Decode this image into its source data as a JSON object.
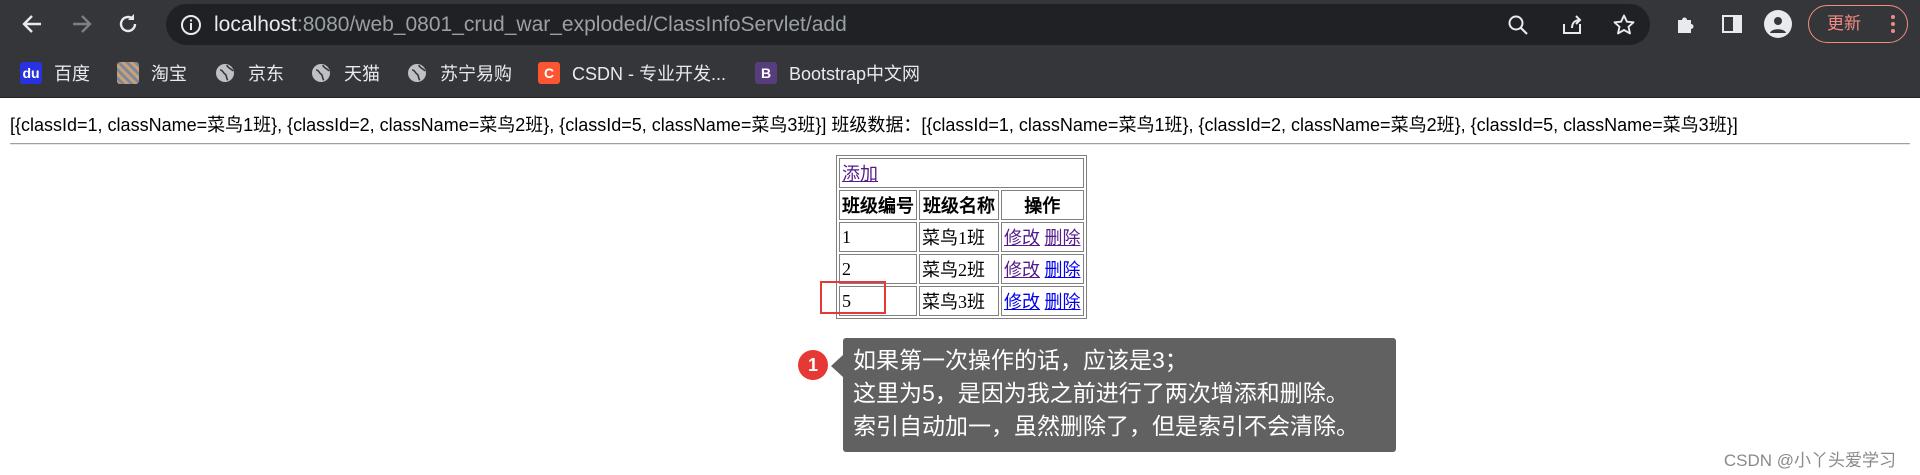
{
  "browser": {
    "url_host": "localhost",
    "url_rest": ":8080/web_0801_crud_war_exploded/ClassInfoServlet/add",
    "update_label": "更新"
  },
  "bookmarks": [
    {
      "label": "百度",
      "icon": "baidu-icon",
      "color": "#2932e1"
    },
    {
      "label": "淘宝",
      "icon": "taobao-icon",
      "color": "#8a8a8a"
    },
    {
      "label": "京东",
      "icon": "globe-icon",
      "color": "#bdc1c6"
    },
    {
      "label": "天猫",
      "icon": "globe-icon",
      "color": "#bdc1c6"
    },
    {
      "label": "苏宁易购",
      "icon": "globe-icon",
      "color": "#bdc1c6"
    },
    {
      "label": "CSDN - 专业开发...",
      "icon": "csdn-icon",
      "color": "#fc5531"
    },
    {
      "label": "Bootstrap中文网",
      "icon": "bootstrap-icon",
      "color": "#563d7c"
    }
  ],
  "page": {
    "debug_text": "[{classId=1, className=菜鸟1班}, {classId=2, className=菜鸟2班}, {classId=5, className=菜鸟3班}] 班级数据：[{classId=1, className=菜鸟1班}, {classId=2, className=菜鸟2班}, {classId=5, className=菜鸟3班}]",
    "add_link": "添加",
    "headers": [
      "班级编号",
      "班级名称",
      "操作"
    ],
    "rows": [
      {
        "id": "1",
        "name": "菜鸟1班",
        "edit": "修改",
        "delete": "删除"
      },
      {
        "id": "2",
        "name": "菜鸟2班",
        "edit": "修改",
        "delete": "删除"
      },
      {
        "id": "5",
        "name": "菜鸟3班",
        "edit": "修改",
        "delete": "删除"
      }
    ]
  },
  "annotation": {
    "badge": "1",
    "lines": [
      "如果第一次操作的话，应该是3；",
      "这里为5，是因为我之前进行了两次增添和删除。",
      "索引自动加一，虽然删除了，但是索引不会清除。"
    ],
    "highlight_color": "#e53935"
  },
  "watermark": "CSDN @小丫头爱学习"
}
